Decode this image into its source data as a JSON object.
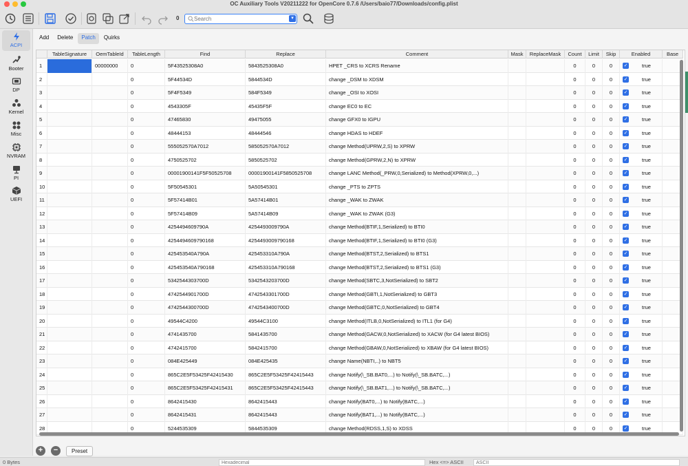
{
  "app": {
    "title": "OC Auxiliary Tools   V20211222 for OpenCore 0.7.6   /Users/baio77/Downloads/config.plist"
  },
  "colors": {
    "accent": "#2f6fe5",
    "selection": "#2a6cdc",
    "close": "#ff5f57",
    "minimize": "#febc2e",
    "zoom": "#28c840"
  },
  "toolbar": {
    "search_placeholder": "Search",
    "search_prefix": "0"
  },
  "sidebar": {
    "items": [
      {
        "label": "ACPI",
        "icon": "lightning-icon"
      },
      {
        "label": "Booter",
        "icon": "boot-icon"
      },
      {
        "label": "DP",
        "icon": "display-icon"
      },
      {
        "label": "Kernel",
        "icon": "kernel-icon"
      },
      {
        "label": "Misc",
        "icon": "misc-icon"
      },
      {
        "label": "NVRAM",
        "icon": "chip-icon"
      },
      {
        "label": "PI",
        "icon": "monitor-icon"
      },
      {
        "label": "UEFI",
        "icon": "cube-icon"
      }
    ]
  },
  "tabs": [
    "Add",
    "Delete",
    "Patch",
    "Quirks"
  ],
  "table": {
    "columns": [
      "",
      "TableSignature",
      "OemTableId",
      "TableLength",
      "Find",
      "Replace",
      "Comment",
      "Mask",
      "ReplaceMask",
      "Count",
      "Limit",
      "Skip",
      "Enabled",
      "Base"
    ],
    "rows": [
      {
        "n": "1",
        "sig": "",
        "oem": "00000000",
        "len": "0",
        "find": "5F43525308A0",
        "replace": "5843525308A0",
        "comment": "HPET _CRS to XCRS Rename",
        "count": "0",
        "limit": "0",
        "skip": "0",
        "enabled": "true"
      },
      {
        "n": "2",
        "sig": "",
        "oem": "",
        "len": "0",
        "find": "5F44534D",
        "replace": "5844534D",
        "comment": "change _DSM to XDSM",
        "count": "0",
        "limit": "0",
        "skip": "0",
        "enabled": "true"
      },
      {
        "n": "3",
        "sig": "",
        "oem": "",
        "len": "0",
        "find": "5F4F5349",
        "replace": "584F5349",
        "comment": "change _OSI to XOSI",
        "count": "0",
        "limit": "0",
        "skip": "0",
        "enabled": "true"
      },
      {
        "n": "4",
        "sig": "",
        "oem": "",
        "len": "0",
        "find": "4543305F",
        "replace": "45435F5F",
        "comment": "change EC0 to EC",
        "count": "0",
        "limit": "0",
        "skip": "0",
        "enabled": "true"
      },
      {
        "n": "5",
        "sig": "",
        "oem": "",
        "len": "0",
        "find": "47465830",
        "replace": "49475055",
        "comment": "change GFX0 to IGPU",
        "count": "0",
        "limit": "0",
        "skip": "0",
        "enabled": "true"
      },
      {
        "n": "6",
        "sig": "",
        "oem": "",
        "len": "0",
        "find": "48444153",
        "replace": "48444546",
        "comment": "change HDAS to HDEF",
        "count": "0",
        "limit": "0",
        "skip": "0",
        "enabled": "true"
      },
      {
        "n": "7",
        "sig": "",
        "oem": "",
        "len": "0",
        "find": "555052570A7012",
        "replace": "585052570A7012",
        "comment": "change Method(UPRW,2,S) to XPRW",
        "count": "0",
        "limit": "0",
        "skip": "0",
        "enabled": "true"
      },
      {
        "n": "8",
        "sig": "",
        "oem": "",
        "len": "0",
        "find": "4750525702",
        "replace": "5850525702",
        "comment": "change Method(GPRW,2,N) to XPRW",
        "count": "0",
        "limit": "0",
        "skip": "0",
        "enabled": "true"
      },
      {
        "n": "9",
        "sig": "",
        "oem": "",
        "len": "0",
        "find": "00001900141F5F50525708",
        "replace": "00001900141F5850525708",
        "comment": "change LANC Method(_PRW,0,Serialized) to Method(XPRW,0,...)",
        "count": "0",
        "limit": "0",
        "skip": "0",
        "enabled": "true"
      },
      {
        "n": "10",
        "sig": "",
        "oem": "",
        "len": "0",
        "find": "5F50545301",
        "replace": "5A50545301",
        "comment": "change _PTS to ZPTS",
        "count": "0",
        "limit": "0",
        "skip": "0",
        "enabled": "true"
      },
      {
        "n": "11",
        "sig": "",
        "oem": "",
        "len": "0",
        "find": "5F57414B01",
        "replace": "5A57414B01",
        "comment": "change _WAK to ZWAK",
        "count": "0",
        "limit": "0",
        "skip": "0",
        "enabled": "true"
      },
      {
        "n": "12",
        "sig": "",
        "oem": "",
        "len": "0",
        "find": "5F57414B09",
        "replace": "5A57414B09",
        "comment": "change _WAK to ZWAK (G3)",
        "count": "0",
        "limit": "0",
        "skip": "0",
        "enabled": "true"
      },
      {
        "n": "13",
        "sig": "",
        "oem": "",
        "len": "0",
        "find": "4254494609790A",
        "replace": "4254493009790A",
        "comment": "change Method(BTIF,1,Serialized) to BTI0",
        "count": "0",
        "limit": "0",
        "skip": "0",
        "enabled": "true"
      },
      {
        "n": "14",
        "sig": "",
        "oem": "",
        "len": "0",
        "find": "4254494609790168",
        "replace": "4254493009790168",
        "comment": "change Method(BTIF,1,Serialized) to BTI0 (G3)",
        "count": "0",
        "limit": "0",
        "skip": "0",
        "enabled": "true"
      },
      {
        "n": "15",
        "sig": "",
        "oem": "",
        "len": "0",
        "find": "425453540A790A",
        "replace": "425453310A790A",
        "comment": "change Method(BTST,2,Serialized) to BTS1",
        "count": "0",
        "limit": "0",
        "skip": "0",
        "enabled": "true"
      },
      {
        "n": "16",
        "sig": "",
        "oem": "",
        "len": "0",
        "find": "425453540A790168",
        "replace": "425453310A790168",
        "comment": "change Method(BTST,2,Serialized) to BTS1 (G3)",
        "count": "0",
        "limit": "0",
        "skip": "0",
        "enabled": "true"
      },
      {
        "n": "17",
        "sig": "",
        "oem": "",
        "len": "0",
        "find": "5342544303700D",
        "replace": "5342543203700D",
        "comment": "change Method(SBTC,3,NotSerialized) to SBT2",
        "count": "0",
        "limit": "0",
        "skip": "0",
        "enabled": "true"
      },
      {
        "n": "18",
        "sig": "",
        "oem": "",
        "len": "0",
        "find": "4742544901700D",
        "replace": "4742543301700D",
        "comment": "change Method(GBTI,1,NotSerialized) to GBT3",
        "count": "0",
        "limit": "0",
        "skip": "0",
        "enabled": "true"
      },
      {
        "n": "19",
        "sig": "",
        "oem": "",
        "len": "0",
        "find": "4742544300700D",
        "replace": "4742543400700D",
        "comment": "change Method(GBTC,0,NotSerialized) to GBT4",
        "count": "0",
        "limit": "0",
        "skip": "0",
        "enabled": "true"
      },
      {
        "n": "20",
        "sig": "",
        "oem": "",
        "len": "0",
        "find": "49544C4200",
        "replace": "49544C3100",
        "comment": "change Method(ITLB,0,NotSerialized) to ITL1 (for G4)",
        "count": "0",
        "limit": "0",
        "skip": "0",
        "enabled": "true"
      },
      {
        "n": "21",
        "sig": "",
        "oem": "",
        "len": "0",
        "find": "4741435700",
        "replace": "5841435700",
        "comment": "change Method(GACW,0,NotSerialized) to XACW (for G4 latest BIOS)",
        "count": "0",
        "limit": "0",
        "skip": "0",
        "enabled": "true"
      },
      {
        "n": "22",
        "sig": "",
        "oem": "",
        "len": "0",
        "find": "4742415700",
        "replace": "5842415700",
        "comment": "change Method(GBAW,0,NotSerialized) to XBAW (for G4 latest BIOS)",
        "count": "0",
        "limit": "0",
        "skip": "0",
        "enabled": "true"
      },
      {
        "n": "23",
        "sig": "",
        "oem": "",
        "len": "0",
        "find": "084E425449",
        "replace": "084E425435",
        "comment": "change Name(NBTI,..) to NBT5",
        "count": "0",
        "limit": "0",
        "skip": "0",
        "enabled": "true"
      },
      {
        "n": "24",
        "sig": "",
        "oem": "",
        "len": "0",
        "find": "865C2E5F53425F42415430",
        "replace": "865C2E5F53425F42415443",
        "comment": "change Notify(\\_SB.BAT0,...) to Notify(\\_SB.BATC,...)",
        "count": "0",
        "limit": "0",
        "skip": "0",
        "enabled": "true"
      },
      {
        "n": "25",
        "sig": "",
        "oem": "",
        "len": "0",
        "find": "865C2E5F53425F42415431",
        "replace": "865C2E5F53425F42415443",
        "comment": "change Notify(\\_SB.BAT1,...) to Notify(\\_SB.BATC,...)",
        "count": "0",
        "limit": "0",
        "skip": "0",
        "enabled": "true"
      },
      {
        "n": "26",
        "sig": "",
        "oem": "",
        "len": "0",
        "find": "8642415430",
        "replace": "8642415443",
        "comment": "change Notify(BAT0,...) to Notify(BATC,...)",
        "count": "0",
        "limit": "0",
        "skip": "0",
        "enabled": "true"
      },
      {
        "n": "27",
        "sig": "",
        "oem": "",
        "len": "0",
        "find": "8642415431",
        "replace": "8642415443",
        "comment": "change Notify(BAT1,...) to Notify(BATC,...)",
        "count": "0",
        "limit": "0",
        "skip": "0",
        "enabled": "true"
      },
      {
        "n": "28",
        "sig": "",
        "oem": "",
        "len": "0",
        "find": "5244535309",
        "replace": "5844535309",
        "comment": "change Method(RDSS,1,S) to XDSS",
        "count": "0",
        "limit": "0",
        "skip": "0",
        "enabled": "true"
      }
    ]
  },
  "footer": {
    "add_label": "+",
    "remove_label": "−",
    "preset_label": "Preset"
  },
  "statusbar": {
    "size_text": "0 Bytes",
    "hex_placeholder": "Hexadecimal",
    "hex_ascii_label": "Hex <=> ASCII",
    "ascii_placeholder": "ASCII"
  }
}
